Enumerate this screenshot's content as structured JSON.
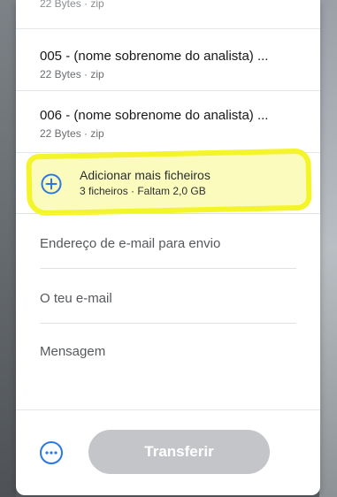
{
  "files": [
    {
      "name": "22 Bytes · zip",
      "meta": ""
    },
    {
      "name": "005 - (nome sobrenome do analista) ...",
      "meta": "22 Bytes · zip"
    },
    {
      "name": "006 - (nome sobrenome do analista) ...",
      "meta": "22 Bytes · zip"
    }
  ],
  "add_files": {
    "label": "Adicionar mais ficheiros",
    "meta": "3 ficheiros · Faltam 2,0 GB"
  },
  "form": {
    "recipient_placeholder": "Endereço de e-mail para envio",
    "sender_placeholder": "O teu e-mail",
    "message_placeholder": "Mensagem"
  },
  "actions": {
    "transfer_label": "Transferir",
    "more_icon": "ellipsis-circle-icon"
  },
  "colors": {
    "accent": "#2b78e4",
    "button_disabled": "#c3c5c8",
    "highlight": "#f4f42a"
  }
}
